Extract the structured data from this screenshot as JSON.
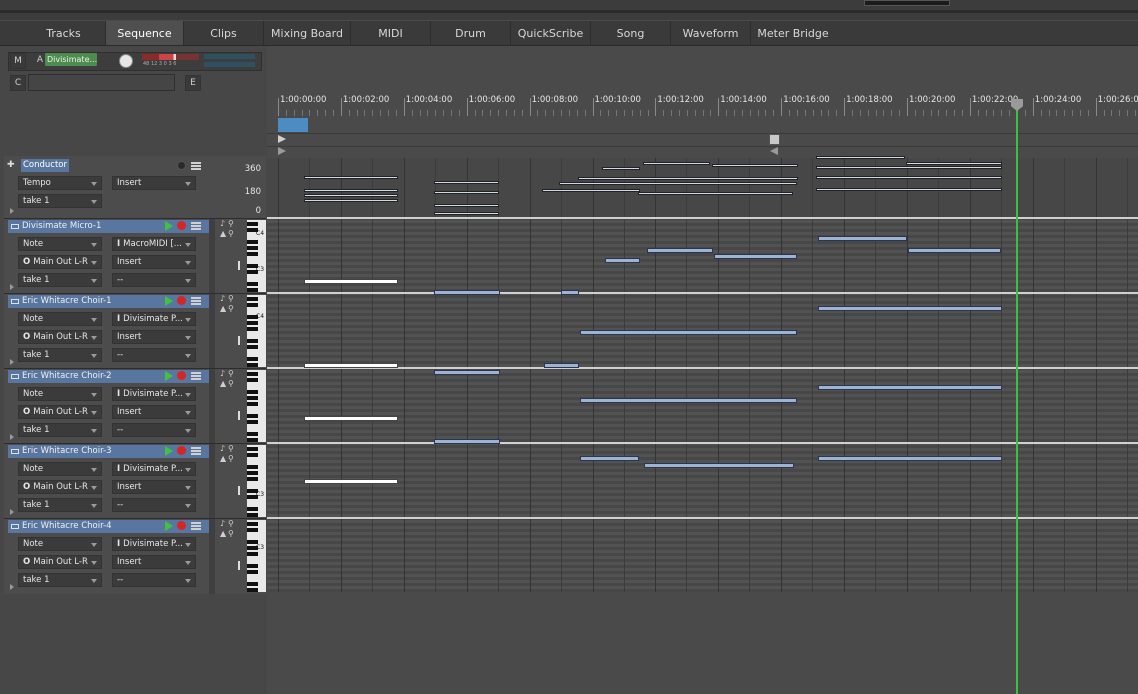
{
  "tabs": [
    {
      "label": "Tracks",
      "active": false
    },
    {
      "label": "Sequence",
      "active": true
    },
    {
      "label": "Clips",
      "active": false
    },
    {
      "label": "Mixing Board",
      "active": false
    },
    {
      "label": "MIDI",
      "active": false
    },
    {
      "label": "Drum",
      "active": false
    },
    {
      "label": "QuickScribe",
      "active": false
    },
    {
      "label": "Song",
      "active": false
    },
    {
      "label": "Waveform",
      "active": false
    },
    {
      "label": "Meter Bridge",
      "active": false
    }
  ],
  "header": {
    "m_label": "M",
    "a_label": "A",
    "c_label": "C",
    "e_label": "E",
    "selected_track": "Divisimate...",
    "meter_scale": "48  12  3 0 3 6"
  },
  "ruler": {
    "labels": [
      "1:00:00:00",
      "1:00:02:00",
      "1:00:04:00",
      "1:00:06:00",
      "1:00:08:00",
      "1:00:10:00",
      "1:00:12:00",
      "1:00:14:00",
      "1:00:16:00",
      "1:00:18:00",
      "1:00:20:00",
      "1:00:22:00",
      "1:00:24:00",
      "1:00:26:00"
    ]
  },
  "conductor": {
    "name": "Conductor",
    "field1": "Tempo",
    "field2": "Insert",
    "take": "take 1",
    "scale": [
      "360",
      "180",
      "0"
    ]
  },
  "tracks": [
    {
      "name": "Divisimate Micro-1",
      "type": "Note",
      "output": "Main Out L-R",
      "input": "MacroMIDI [...",
      "insert": "Insert",
      "take": "take 1",
      "take_insert": "--",
      "key_labels": [
        "C4",
        "C3"
      ]
    },
    {
      "name": "Eric Whitacre Choir-1",
      "type": "Note",
      "output": "Main Out L-R",
      "input": "Divisimate P...",
      "insert": "Insert",
      "take": "take 1",
      "take_insert": "--",
      "key_labels": [
        "C4"
      ]
    },
    {
      "name": "Eric Whitacre Choir-2",
      "type": "Note",
      "output": "Main Out L-R",
      "input": "Divisimate P...",
      "insert": "Insert",
      "take": "take 1",
      "take_insert": "--",
      "key_labels": []
    },
    {
      "name": "Eric Whitacre Choir-3",
      "type": "Note",
      "output": "Main Out L-R",
      "input": "Divisimate P...",
      "insert": "Insert",
      "take": "take 1",
      "take_insert": "--",
      "key_labels": [
        "C3"
      ]
    },
    {
      "name": "Eric Whitacre Choir-4",
      "type": "Note",
      "output": "Main Out L-R",
      "input": "Divisimate P...",
      "insert": "Insert",
      "take": "take 1",
      "take_insert": "--",
      "key_labels": [
        "C3"
      ]
    }
  ],
  "colors": {
    "track_header": "#5876a0",
    "note": "#9eb2d2",
    "playhead": "#3fbf3f",
    "selection": "#5f91be",
    "record": "#d52525",
    "play": "#3fc23f"
  },
  "icons": [
    "play-icon",
    "record-icon",
    "menu-icon",
    "tool-icon",
    "zoom-icon",
    "expand-icon"
  ]
}
